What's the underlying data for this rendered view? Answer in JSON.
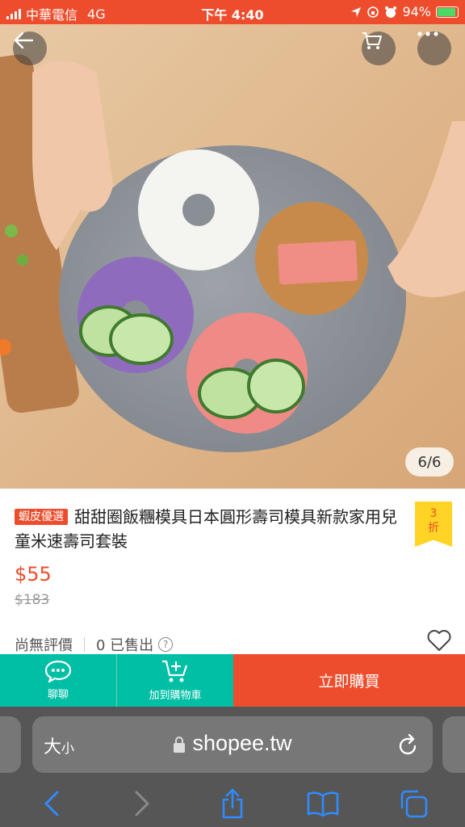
{
  "status_bar": {
    "carrier": "中華電信",
    "network": "4G",
    "time": "下午 4:40",
    "battery": "94%"
  },
  "gallery": {
    "counter": "6/6"
  },
  "product": {
    "badge": "蝦皮優選",
    "title": "甜甜圈飯糰模具日本圓形壽司模具新款家用兒童米速壽司套裝",
    "discount_number": "3",
    "discount_unit": "折",
    "price": "$55",
    "original_price": "$183",
    "rating_text": "尚無評價",
    "sold_text": "0 已售出"
  },
  "actions": {
    "chat_label": "聊聊",
    "add_cart_label": "加到購物車",
    "buy_label": "立即購買"
  },
  "browser": {
    "text_size": "大",
    "text_size_small": "小",
    "url": "shopee.tw"
  },
  "colors": {
    "brand": "#ee4d2d",
    "teal": "#00bfa5",
    "badge_yellow": "#ffd424"
  }
}
